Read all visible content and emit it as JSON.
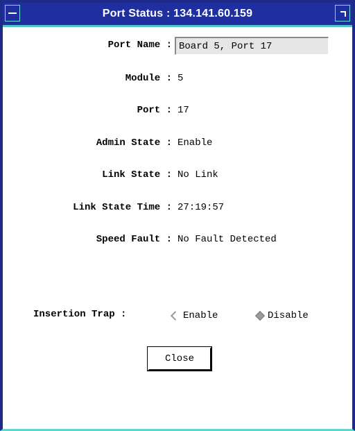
{
  "window": {
    "title": "Port Status : 134.141.60.159"
  },
  "fields": {
    "port_name": {
      "label": "Port Name :",
      "value": "Board 5, Port 17"
    },
    "module": {
      "label": "Module :",
      "value": "5"
    },
    "port": {
      "label": "Port :",
      "value": "17"
    },
    "admin_state": {
      "label": "Admin State :",
      "value": "Enable"
    },
    "link_state": {
      "label": "Link State :",
      "value": "No Link"
    },
    "link_state_time": {
      "label": "Link State Time :",
      "value": "27:19:57"
    },
    "speed_fault": {
      "label": "Speed Fault :",
      "value": "No Fault Detected"
    }
  },
  "insertion_trap": {
    "label": "Insertion Trap :",
    "options": [
      {
        "label": "Enable",
        "selected": false
      },
      {
        "label": "Disable",
        "selected": true
      }
    ]
  },
  "actions": {
    "close_label": "Close"
  },
  "icons": {
    "window_menu": "window-menu-icon",
    "resize": "resize-corner-icon",
    "radio_unselected": "diamond-radio-off-icon",
    "radio_selected": "diamond-radio-on-icon"
  },
  "colors": {
    "titlebar": "#1f2fa0",
    "border_accent": "#4fc7c7"
  }
}
